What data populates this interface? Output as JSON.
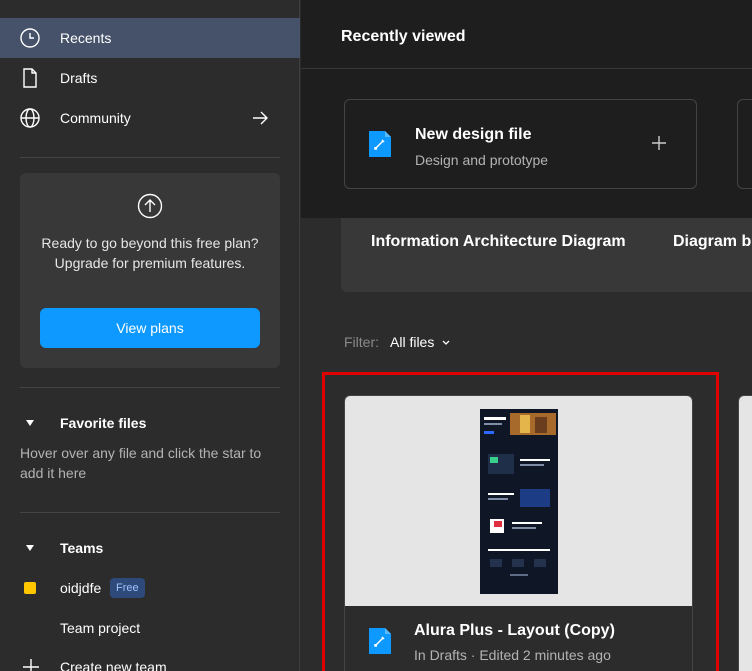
{
  "sidebar": {
    "nav": [
      {
        "label": "Recents",
        "icon": "clock-icon",
        "active": true
      },
      {
        "label": "Drafts",
        "icon": "file-icon",
        "active": false
      },
      {
        "label": "Community",
        "icon": "globe-icon",
        "active": false
      }
    ],
    "upgrade": {
      "text": "Ready to go beyond this free plan? Upgrade for premium features.",
      "button": "View plans",
      "icon": "arrow-up-circle-icon"
    },
    "favorites": {
      "title": "Favorite files",
      "hint": "Hover over any file and click the star to add it here"
    },
    "teams": {
      "title": "Teams",
      "team_name": "oidjdfe",
      "team_badge": "Free",
      "project": "Team project",
      "create": "Create new team"
    }
  },
  "main": {
    "title": "Recently viewed",
    "new_file": {
      "title": "New design file",
      "subtitle": "Design and prototype",
      "icon": "figma-design-file-icon"
    },
    "templates": [
      "Information Architecture Diagram",
      "Diagram b"
    ],
    "filter": {
      "label": "Filter:",
      "value": "All files"
    },
    "files": [
      {
        "name": "Alura Plus - Layout (Copy)",
        "meta": "In Drafts · Edited 2 minutes ago",
        "icon": "figma-design-file-icon"
      }
    ]
  },
  "colors": {
    "accent": "#0d99ff",
    "active_nav": "#46526a",
    "highlight": "#e00000",
    "team_swatch": "#ffc700"
  }
}
